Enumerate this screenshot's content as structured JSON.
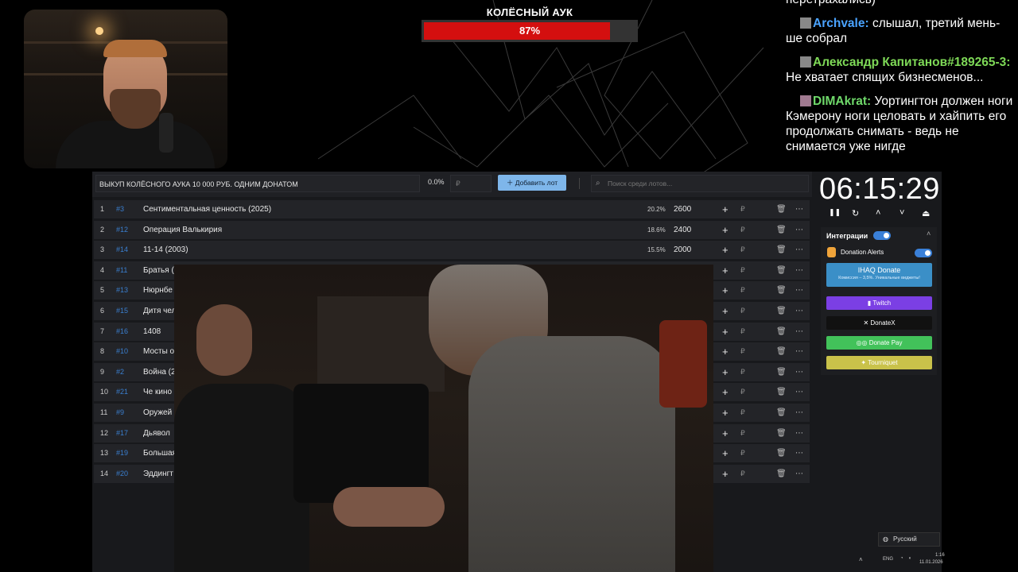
{
  "auction": {
    "title": "КОЛЁСНЫЙ АУК",
    "progress_percent": 87,
    "progress_label": "87%",
    "fill_color": "#d40f0f"
  },
  "chat": {
    "messages": [
      {
        "user": "",
        "text": "перетрахались)"
      },
      {
        "user": "Archvale:",
        "text": " слышал, третий мень-ше собрал"
      },
      {
        "user": "Александр Капитанов#189265-3:",
        "text": " Не хватает спящих бизнесменов..."
      },
      {
        "user": "DIMAkrat:",
        "text": " Уортингтон должен ноги Кэмерону ноги целовать и хайпить его продолжать снимать - ведь не снимается уже нигде"
      }
    ]
  },
  "toolbar": {
    "lot_title": "ВЫКУП КОЛЁСНОГО АУКА 10 000 РУБ. ОДНИМ ДОНАТОМ",
    "percent": "0.0%",
    "price_placeholder": "₽",
    "add_lot_label": "Добавить лот",
    "search_placeholder": "Поиск среди лотов..."
  },
  "lots": [
    {
      "idx": "1",
      "id": "#3",
      "name": "Сентиментальная ценность (2025)",
      "pct": "20.2%",
      "amount": "2600"
    },
    {
      "idx": "2",
      "id": "#12",
      "name": "Операция Валькирия",
      "pct": "18.6%",
      "amount": "2400"
    },
    {
      "idx": "3",
      "id": "#14",
      "name": "11-14 (2003)",
      "pct": "15.5%",
      "amount": "2000"
    },
    {
      "idx": "4",
      "id": "#11",
      "name": "Братья (",
      "pct": "",
      "amount": ""
    },
    {
      "idx": "5",
      "id": "#13",
      "name": "Нюрнбе",
      "pct": "",
      "amount": ""
    },
    {
      "idx": "6",
      "id": "#15",
      "name": "Дитя чел",
      "pct": "",
      "amount": ""
    },
    {
      "idx": "7",
      "id": "#16",
      "name": "1408",
      "pct": "",
      "amount": ""
    },
    {
      "idx": "8",
      "id": "#10",
      "name": "Мосты о",
      "pct": "",
      "amount": ""
    },
    {
      "idx": "9",
      "id": "#2",
      "name": "Война (2",
      "pct": "",
      "amount": ""
    },
    {
      "idx": "10",
      "id": "#21",
      "name": "Че кино",
      "pct": "",
      "amount": ""
    },
    {
      "idx": "11",
      "id": "#9",
      "name": "Оружей",
      "pct": "",
      "amount": ""
    },
    {
      "idx": "12",
      "id": "#17",
      "name": "Дьявол",
      "pct": "",
      "amount": ""
    },
    {
      "idx": "13",
      "id": "#19",
      "name": "Большая",
      "pct": "",
      "amount": ""
    },
    {
      "idx": "14",
      "id": "#20",
      "name": "Эддингт",
      "pct": "",
      "amount": ""
    }
  ],
  "row_controls": {
    "plus": "+",
    "currency": "₽",
    "trash": "🗑",
    "more": "⋯"
  },
  "timer": {
    "value": "06:15:29"
  },
  "timer_controls": {
    "pause": "❚❚",
    "reset": "↻",
    "up": "˄",
    "down": "˅",
    "collapse": "⏏"
  },
  "integrations": {
    "title": "Интеграции",
    "collapse_icon": "˄",
    "donation_alerts_label": "Donation Alerts",
    "ihaq": {
      "label": "IHAQ Donate",
      "sub": "Комиссия – 3,5%. Уникальные виджеты!"
    },
    "buttons": [
      {
        "label": "Twitch",
        "icon": "twitch-icon",
        "color": "#7b3fe4",
        "text_color": "#ffffff"
      },
      {
        "label": "DonateX",
        "icon": "x-icon",
        "color": "#111111",
        "text_color": "#ffffff"
      },
      {
        "label": "Donate Pay",
        "icon": "donatepay-icon",
        "color": "#42c25a",
        "text_color": "#ffffff"
      },
      {
        "label": "Tourniquet",
        "icon": "tourniquet-icon",
        "color": "#c9c24a",
        "text_color": "#ffffff"
      }
    ]
  },
  "language": {
    "selected": "Русский"
  },
  "taskbar": {
    "lang": "ENG",
    "time": "1:16",
    "date": "11.01.2026"
  }
}
